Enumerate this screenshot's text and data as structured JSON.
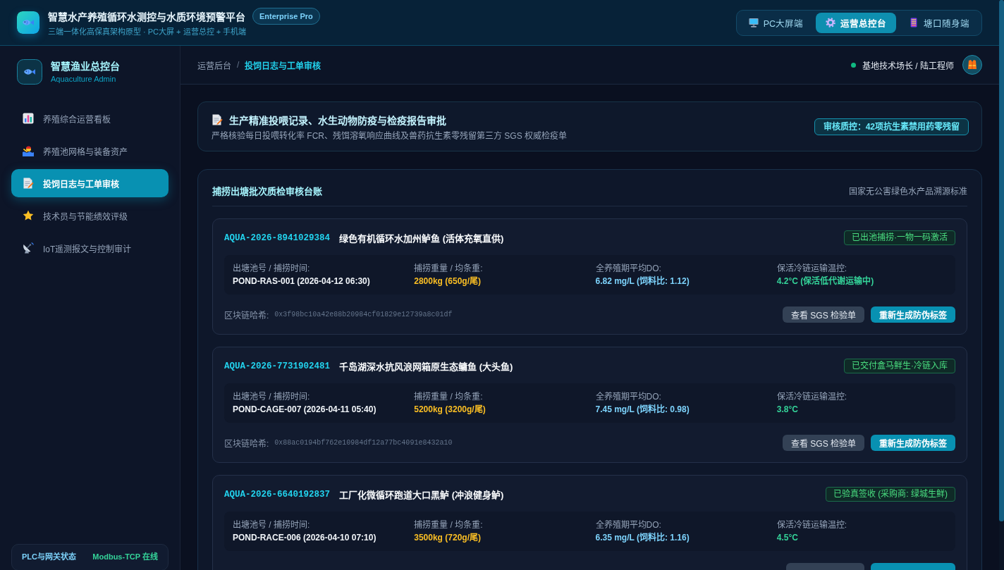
{
  "header": {
    "title": "智慧水产养殖循环水测控与水质环境预警平台",
    "badge": "Enterprise Pro",
    "subtitle": "三端一体化高保真架构原型 · PC大屏 + 运营总控 + 手机端",
    "tabs": [
      {
        "label": "PC大屏端",
        "selected": false
      },
      {
        "label": "运营总控台",
        "selected": true
      },
      {
        "label": "塘口随身端",
        "selected": false
      }
    ]
  },
  "sidebar": {
    "title": "智慧渔业总控台",
    "subtitle": "Aquaculture Admin",
    "items": [
      {
        "label": "养殖综合运营看板",
        "selected": false
      },
      {
        "label": "养殖池网格与装备资产",
        "selected": false
      },
      {
        "label": "投饲日志与工单审核",
        "selected": true
      },
      {
        "label": "技术员与节能绩效评级",
        "selected": false
      },
      {
        "label": "IoT遥测报文与控制审计",
        "selected": false
      }
    ],
    "gateway": {
      "label": "PLC与网关状态",
      "value": "Modbus-TCP 在线"
    }
  },
  "breadcrumb": {
    "separator": "/",
    "items": [
      {
        "label": "运营后台",
        "current": false
      },
      {
        "label": "投饲日志与工单审核",
        "current": true
      }
    ]
  },
  "user": {
    "name": "基地技术场长 / 陆工程师",
    "online": true
  },
  "banner": {
    "title": "生产精准投喂记录、水生动物防疫与检疫报告审批",
    "description": "严格核验每日投喂转化率 FCR、残饵溶氧响应曲线及兽药抗生素零残留第三方 SGS 权威检疫单",
    "badge": "审核质控：42项抗生素禁用药零残留"
  },
  "ledger": {
    "title": "捕捞出塘批次质检审核台账",
    "standard": "国家无公害绿色水产品溯源标准",
    "records": [
      {
        "id": "AQUA-2026-8941029384",
        "name": "绿色有机循环水加州鲈鱼 (活体充氧直供)",
        "status": "已出池捕捞·一物一码激活",
        "metrics": [
          {
            "label": "出塘池号 / 捕捞时间:",
            "value": "POND-RAS-001 (2026-04-12 06:30)"
          },
          {
            "label": "捕捞重量 / 均条重:",
            "value": "2800kg (650g/尾)"
          },
          {
            "label": "全养殖期平均DO:",
            "value": "6.82 mg/L (饲料比: 1.12)"
          },
          {
            "label": "保活冷链运输温控:",
            "value": "4.2°C (保活低代谢运输中)"
          }
        ],
        "hash_label": "区块链哈希:",
        "hash": "0x3f98bc10a42e88b20984cf01829e12739a8c01df",
        "buttons": [
          {
            "label": "查看 SGS 检验单",
            "kind": "secondary"
          },
          {
            "label": "重新生成防伪标签",
            "kind": "primary"
          }
        ]
      },
      {
        "id": "AQUA-2026-7731902481",
        "name": "千岛湖深水抗风浪网箱原生态鳙鱼 (大头鱼)",
        "status": "已交付盒马鲜生·冷链入库",
        "metrics": [
          {
            "label": "出塘池号 / 捕捞时间:",
            "value": "POND-CAGE-007 (2026-04-11 05:40)"
          },
          {
            "label": "捕捞重量 / 均条重:",
            "value": "5200kg (3200g/尾)"
          },
          {
            "label": "全养殖期平均DO:",
            "value": "7.45 mg/L (饲料比: 0.98)"
          },
          {
            "label": "保活冷链运输温控:",
            "value": "3.8°C"
          }
        ],
        "hash_label": "区块链哈希:",
        "hash": "0x88ac0194bf762e10984df12a77bc4091e8432a10",
        "buttons": [
          {
            "label": "查看 SGS 检验单",
            "kind": "secondary"
          },
          {
            "label": "重新生成防伪标签",
            "kind": "primary"
          }
        ]
      },
      {
        "id": "AQUA-2026-6640192837",
        "name": "工厂化微循环跑道大口黑鲈 (冲浪健身鲈)",
        "status": "已验真签收 (采购商: 绿城生鲜)",
        "metrics": [
          {
            "label": "出塘池号 / 捕捞时间:",
            "value": "POND-RACE-006 (2026-04-10 07:10)"
          },
          {
            "label": "捕捞重量 / 均条重:",
            "value": "3500kg (720g/尾)"
          },
          {
            "label": "全养殖期平均DO:",
            "value": "6.35 mg/L (饲料比: 1.16)"
          },
          {
            "label": "保活冷链运输温控:",
            "value": "4.5°C"
          }
        ],
        "buttons": [
          {
            "kind": "secondary"
          },
          {
            "kind": "primary"
          }
        ]
      }
    ]
  }
}
